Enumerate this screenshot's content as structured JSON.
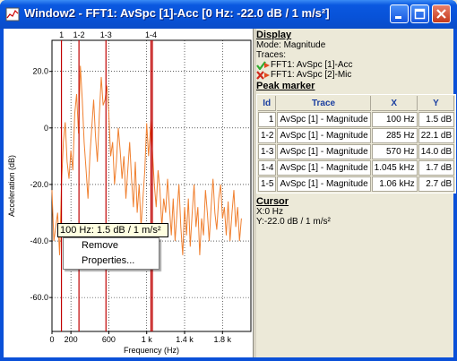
{
  "window": {
    "title": "Window2 - FFT1: AvSpc [1]-Acc [0 Hz: -22.0 dB / 1 m/s²]",
    "icon": "chart-icon",
    "buttons": [
      "minimize-icon",
      "maximize-icon",
      "close-icon"
    ]
  },
  "chart_data": {
    "type": "line",
    "xlabel": "Frequency (Hz)",
    "ylabel": "Acceleration (dB)",
    "xlim": [
      0,
      2100
    ],
    "ylim": [
      -72,
      31
    ],
    "x_ticks": [
      {
        "v": 0,
        "label": "0"
      },
      {
        "v": 200,
        "label": "200"
      },
      {
        "v": 600,
        "label": "600"
      },
      {
        "v": 1000,
        "label": "1 k"
      },
      {
        "v": 1400,
        "label": "1.4 k"
      },
      {
        "v": 1800,
        "label": "1.8 k"
      }
    ],
    "y_ticks": [
      {
        "v": 20,
        "label": "20.0"
      },
      {
        "v": 0,
        "label": "0"
      },
      {
        "v": -20,
        "label": "-20.0"
      },
      {
        "v": -40,
        "label": "-40.0"
      },
      {
        "v": -60,
        "label": "-60.0"
      }
    ],
    "grid": true,
    "series": [
      {
        "color": "#F08030",
        "x": [
          0,
          20,
          40,
          60,
          80,
          100,
          120,
          140,
          160,
          180,
          200,
          220,
          240,
          260,
          280,
          300,
          320,
          340,
          360,
          380,
          400,
          420,
          440,
          460,
          480,
          500,
          520,
          540,
          560,
          580,
          600,
          620,
          640,
          660,
          680,
          700,
          720,
          740,
          760,
          780,
          800,
          820,
          840,
          860,
          880,
          900,
          920,
          940,
          960,
          980,
          1000,
          1020,
          1045,
          1060,
          1080,
          1100,
          1120,
          1140,
          1160,
          1180,
          1200,
          1220,
          1240,
          1260,
          1280,
          1300,
          1320,
          1340,
          1360,
          1380,
          1400,
          1420,
          1440,
          1460,
          1480,
          1500,
          1520,
          1540,
          1560,
          1580,
          1600,
          1620,
          1640,
          1660,
          1680,
          1700,
          1720,
          1740,
          1760,
          1780,
          1800,
          1820,
          1840,
          1860,
          1880,
          1900,
          1920,
          1940,
          1960,
          1980,
          2000
        ],
        "y": [
          -22,
          -40,
          -35,
          -30,
          -45,
          -20,
          -5,
          2,
          -12,
          -18,
          -8,
          -15,
          5,
          12,
          -2,
          22,
          10,
          -5,
          -15,
          -25,
          -10,
          0,
          10,
          -3,
          -12,
          5,
          18,
          8,
          10,
          15,
          5,
          -10,
          -5,
          -20,
          -12,
          0,
          -8,
          -18,
          -10,
          -25,
          -15,
          -5,
          -18,
          -28,
          -12,
          -30,
          -20,
          -35,
          -25,
          -15,
          1.7,
          -10,
          2.7,
          -8,
          -20,
          -28,
          -15,
          -22,
          -35,
          -25,
          -30,
          -18,
          -28,
          -38,
          -25,
          -40,
          -30,
          -20,
          -35,
          -45,
          -28,
          -38,
          -25,
          -42,
          -30,
          -20,
          -35,
          -28,
          -45,
          -32,
          -38,
          -22,
          -30,
          -40,
          -28,
          -18,
          -30,
          -36,
          -25,
          -20,
          -32,
          -28,
          -38,
          -26,
          -40,
          -30,
          -22,
          -35,
          -28,
          -40,
          -32
        ]
      }
    ],
    "markers": [
      {
        "x": 100,
        "label": "1"
      },
      {
        "x": 285,
        "label": "1-2"
      },
      {
        "x": 570,
        "label": "1-3"
      },
      {
        "x": 1045,
        "label": "1-4"
      },
      {
        "x": 1060,
        "label": ""
      }
    ]
  },
  "display": {
    "title": "Display",
    "mode": "Mode: Magnitude",
    "traces_label": "Traces:",
    "traces": [
      {
        "label": "FFT1: AvSpc [1]-Acc",
        "status_icon": "checkmark-icon",
        "status_color": "#2FAA2F"
      },
      {
        "label": "FFT1: AvSpc [2]-Mic",
        "status_icon": "x-cross-icon",
        "status_color": "#D0281C"
      }
    ]
  },
  "peak_marker": {
    "title": "Peak marker",
    "columns": [
      "Id",
      "Trace",
      "X",
      "Y"
    ],
    "rows": [
      [
        "1",
        "AvSpc [1] - Magnitude",
        "100 Hz",
        "1.5 dB"
      ],
      [
        "1-2",
        "AvSpc [1] - Magnitude",
        "285 Hz",
        "22.1 dB"
      ],
      [
        "1-3",
        "AvSpc [1] - Magnitude",
        "570 Hz",
        "14.0 dB"
      ],
      [
        "1-4",
        "AvSpc [1] - Magnitude",
        "1.045 kHz",
        "1.7 dB"
      ],
      [
        "1-5",
        "AvSpc [1] - Magnitude",
        "1.06 kHz",
        "2.7 dB"
      ]
    ]
  },
  "cursor": {
    "title": "Cursor",
    "x": "X:0 Hz",
    "y": "Y:-22.0 dB / 1 m/s²"
  },
  "context": {
    "label": "100 Hz: 1.5 dB / 1 m/s²",
    "items": [
      "Remove",
      "Properties..."
    ]
  }
}
